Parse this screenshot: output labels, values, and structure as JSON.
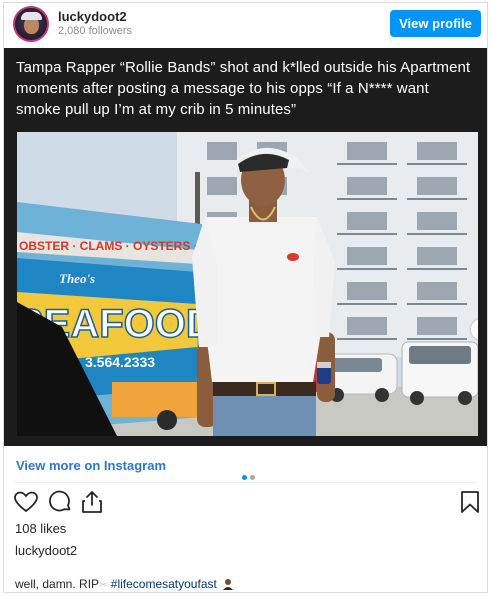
{
  "header": {
    "username": "luckydoot2",
    "followers": "2,080 followers",
    "view_profile_label": "View profile"
  },
  "media": {
    "caption": "Tampa Rapper “Rollie Bands” shot and k*lled outside his Apartment moments after posting a message to his opps “If a N**** want smoke pull up I’m at my crib in 5 minutes”",
    "truck_banner": "OBSTER · CLAMS · OYSTERS · PE",
    "truck_sign": "SEAFOOD",
    "truck_script": "Theo's",
    "truck_phone": "3.564.2333",
    "carousel_total": 2,
    "carousel_active": 1
  },
  "view_more_label": "View more on Instagram",
  "likes": "108 likes",
  "poster": "luckydoot2",
  "post_caption": {
    "text": "well, damn. RIP",
    "hashtag": "#lifecomesatyoufast"
  },
  "colors": {
    "accent": "#0095f6",
    "link": "#2f76c6"
  },
  "icons": [
    "heart-icon",
    "comment-icon",
    "share-icon",
    "bookmark-icon",
    "chevron-right-icon",
    "dove-emoji-icon",
    "person-emoji-icon"
  ]
}
